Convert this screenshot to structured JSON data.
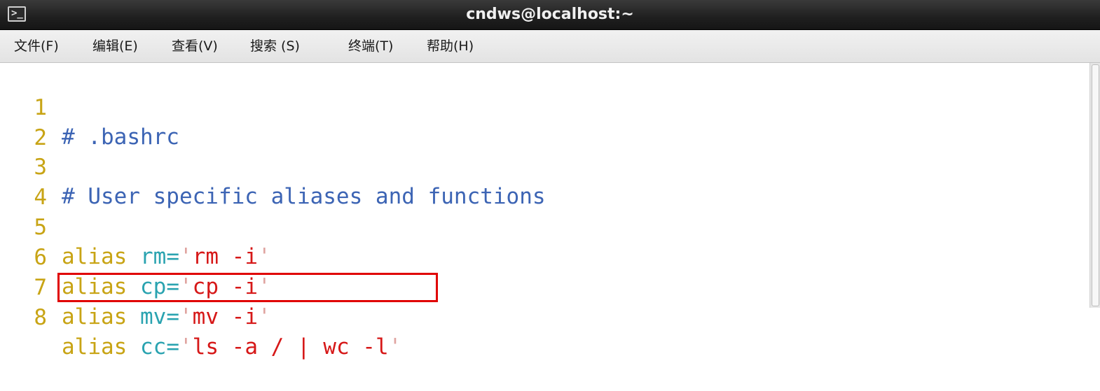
{
  "window": {
    "title": "cndws@localhost:~"
  },
  "menu": [
    {
      "label": "文件(F)"
    },
    {
      "label": "编辑(E)"
    },
    {
      "label": "查看(V)"
    },
    {
      "label": "搜索 (S)"
    },
    {
      "label": "终端(T)"
    },
    {
      "label": "帮助(H)"
    }
  ],
  "editor": {
    "lines": [
      {
        "num": "1",
        "comment": "# .bashrc"
      },
      {
        "num": "2"
      },
      {
        "num": "3",
        "comment": "# User specific aliases and functions"
      },
      {
        "num": "4"
      },
      {
        "num": "5",
        "kw": "alias",
        "name": "rm",
        "eq": "=",
        "q1": "'",
        "value": "rm -i",
        "q2": "'"
      },
      {
        "num": "6",
        "kw": "alias",
        "name": "cp",
        "eq": "=",
        "q1": "'",
        "value": "cp -i",
        "q2": "'"
      },
      {
        "num": "7",
        "kw": "alias",
        "name": "mv",
        "eq": "=",
        "q1": "'",
        "value": "mv -i",
        "q2": "'"
      },
      {
        "num": "8",
        "kw": "alias",
        "name": "cc",
        "eq": "=",
        "q1": "'",
        "value": "ls -a / | wc -l",
        "q2": "'"
      }
    ]
  },
  "colors": {
    "line_number": "#c8a415",
    "comment": "#3c64b4",
    "keyword": "#c8a415",
    "alias_name": "#2aa3b0",
    "string": "#d61818",
    "highlight_box": "#e00000"
  },
  "icons": {
    "window_icon": "terminal-icon"
  }
}
